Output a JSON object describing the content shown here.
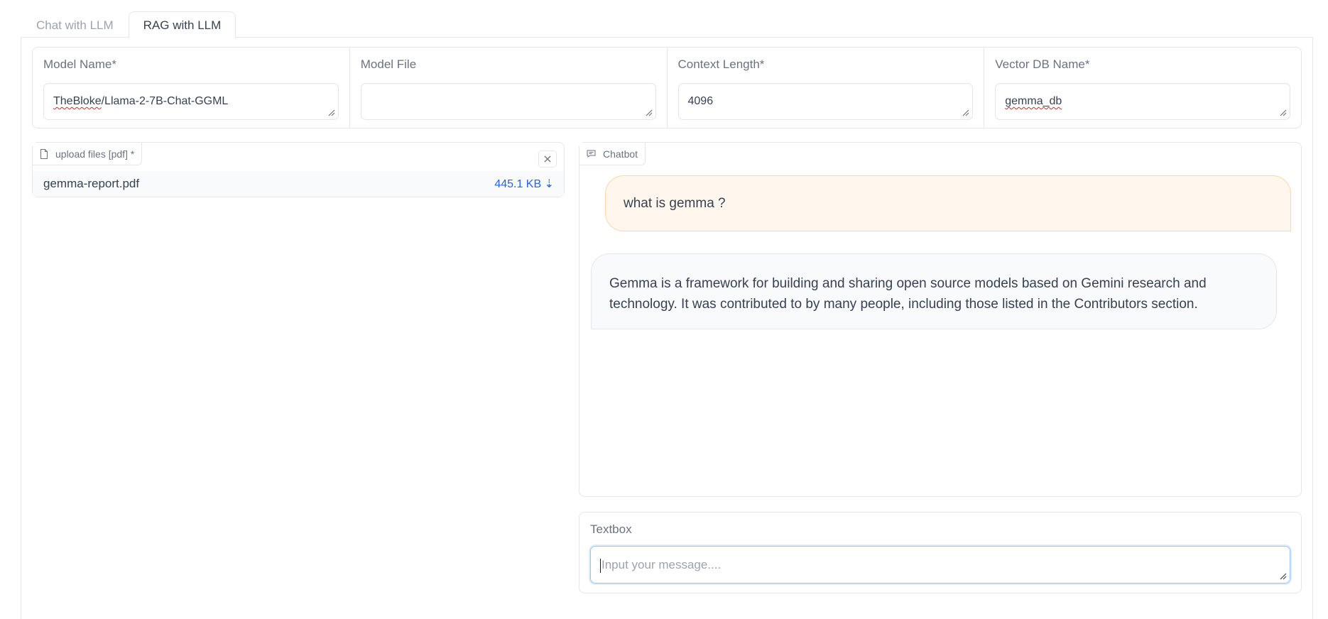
{
  "tabs": [
    {
      "label": "Chat with LLM",
      "active": false
    },
    {
      "label": "RAG with LLM",
      "active": true
    }
  ],
  "settings": {
    "model_name": {
      "label": "Model Name*",
      "value": "TheBloke/Llama-2-7B-Chat-GGML",
      "value_prefix": "TheBloke",
      "value_suffix": "/Llama-2-7B-Chat-GGML"
    },
    "model_file": {
      "label": "Model File",
      "value": ""
    },
    "context_length": {
      "label": "Context Length*",
      "value": "4096"
    },
    "vector_db_name": {
      "label": "Vector DB Name*",
      "value": "gemma_db"
    }
  },
  "upload": {
    "label": "upload files [pdf] *",
    "clear_icon": "close-icon",
    "file_name": "gemma-report.pdf",
    "file_size": "445.1 KB ⇣"
  },
  "chatbot": {
    "label": "Chatbot",
    "messages": [
      {
        "role": "user",
        "text": "what is gemma ?"
      },
      {
        "role": "bot",
        "text": "Gemma is a framework for building and sharing open source models based on Gemini research and technology. It was contributed to by many people, including those listed in the Contributors section."
      }
    ]
  },
  "textbox": {
    "label": "Textbox",
    "placeholder": "Input your message...."
  },
  "colors": {
    "accent_link": "#2563eb",
    "user_bubble": "#fff7ed",
    "bot_bubble": "#f9fafb",
    "border": "#e5e7eb"
  }
}
